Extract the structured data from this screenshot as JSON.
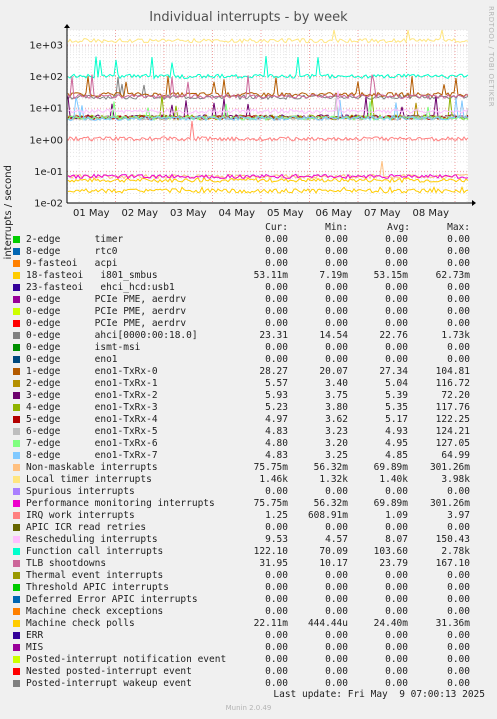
{
  "title": "Individual interrupts - by week",
  "side_label": "RRDTOOL / TOBI OETIKER",
  "footer": {
    "last_update": "Last update: Fri May  9 07:00:13 2025",
    "munin": "Munin 2.0.49"
  },
  "legend_headers": {
    "cur": "Cur:",
    "min": "Min:",
    "avg": "Avg:",
    "max": "Max:"
  },
  "chart_data": {
    "type": "line",
    "ylabel": "interrupts / second",
    "yscale": "log",
    "ylim": [
      0.01,
      3000
    ],
    "yticks": [
      "1e-02",
      "1e-01",
      "1e+00",
      "1e+01",
      "1e+02",
      "1e+03"
    ],
    "x_ticks": [
      "01 May",
      "02 May",
      "03 May",
      "04 May",
      "05 May",
      "06 May",
      "07 May",
      "08 May"
    ],
    "grid": true,
    "series": [
      {
        "name": "2-edge      timer",
        "color": "#00cc00",
        "cur": "0.00",
        "min": "0.00",
        "avg": "0.00",
        "max": "0.00"
      },
      {
        "name": "8-edge      rtc0",
        "color": "#0066b3",
        "cur": "0.00",
        "min": "0.00",
        "avg": "0.00",
        "max": "0.00"
      },
      {
        "name": "9-fasteoi   acpi",
        "color": "#ff8000",
        "cur": "0.00",
        "min": "0.00",
        "avg": "0.00",
        "max": "0.00"
      },
      {
        "name": "18-fasteoi   i801_smbus",
        "color": "#ffcc00",
        "cur": "53.11m",
        "min": "7.19m",
        "avg": "53.15m",
        "max": "62.73m"
      },
      {
        "name": "23-fasteoi   ehci_hcd:usb1",
        "color": "#330099",
        "cur": "0.00",
        "min": "0.00",
        "avg": "0.00",
        "max": "0.00"
      },
      {
        "name": "0-edge      PCIe PME, aerdrv",
        "color": "#990099",
        "cur": "0.00",
        "min": "0.00",
        "avg": "0.00",
        "max": "0.00"
      },
      {
        "name": "0-edge      PCIe PME, aerdrv",
        "color": "#ccff00",
        "cur": "0.00",
        "min": "0.00",
        "avg": "0.00",
        "max": "0.00"
      },
      {
        "name": "0-edge      PCIe PME, aerdrv",
        "color": "#ff0000",
        "cur": "0.00",
        "min": "0.00",
        "avg": "0.00",
        "max": "0.00"
      },
      {
        "name": "0-edge      ahci[0000:00:18.0]",
        "color": "#808080",
        "cur": "23.31",
        "min": "14.54",
        "avg": "22.76",
        "max": "1.73k"
      },
      {
        "name": "0-edge      ismt-msi",
        "color": "#008f00",
        "cur": "0.00",
        "min": "0.00",
        "avg": "0.00",
        "max": "0.00"
      },
      {
        "name": "0-edge      eno1",
        "color": "#00487d",
        "cur": "0.00",
        "min": "0.00",
        "avg": "0.00",
        "max": "0.00"
      },
      {
        "name": "1-edge      eno1-TxRx-0",
        "color": "#b35a00",
        "cur": "28.27",
        "min": "20.07",
        "avg": "27.34",
        "max": "104.81"
      },
      {
        "name": "2-edge      eno1-TxRx-1",
        "color": "#b38f00",
        "cur": "5.57",
        "min": "3.40",
        "avg": "5.04",
        "max": "116.72"
      },
      {
        "name": "3-edge      eno1-TxRx-2",
        "color": "#6b006b",
        "cur": "5.93",
        "min": "3.75",
        "avg": "5.39",
        "max": "72.20"
      },
      {
        "name": "4-edge      eno1-TxRx-3",
        "color": "#8fb300",
        "cur": "5.23",
        "min": "3.80",
        "avg": "5.35",
        "max": "117.76"
      },
      {
        "name": "5-edge      eno1-TxRx-4",
        "color": "#b30000",
        "cur": "4.97",
        "min": "3.62",
        "avg": "5.17",
        "max": "122.25"
      },
      {
        "name": "6-edge      eno1-TxRx-5",
        "color": "#bebebe",
        "cur": "4.83",
        "min": "3.23",
        "avg": "4.93",
        "max": "124.21"
      },
      {
        "name": "7-edge      eno1-TxRx-6",
        "color": "#80ff80",
        "cur": "4.80",
        "min": "3.20",
        "avg": "4.95",
        "max": "127.05"
      },
      {
        "name": "8-edge      eno1-TxRx-7",
        "color": "#80c9ff",
        "cur": "4.83",
        "min": "3.25",
        "avg": "4.85",
        "max": "64.99"
      },
      {
        "name": "Non-maskable interrupts",
        "color": "#ffc080",
        "cur": "75.75m",
        "min": "56.32m",
        "avg": "69.89m",
        "max": "301.26m"
      },
      {
        "name": "Local timer interrupts",
        "color": "#ffe680",
        "cur": "1.46k",
        "min": "1.32k",
        "avg": "1.40k",
        "max": "3.98k"
      },
      {
        "name": "Spurious interrupts",
        "color": "#aa80ff",
        "cur": "0.00",
        "min": "0.00",
        "avg": "0.00",
        "max": "0.00"
      },
      {
        "name": "Performance monitoring interrupts",
        "color": "#ee00cc",
        "cur": "75.75m",
        "min": "56.32m",
        "avg": "69.89m",
        "max": "301.26m"
      },
      {
        "name": "IRQ work interrupts",
        "color": "#ff8080",
        "cur": "1.25",
        "min": "608.91m",
        "avg": "1.09",
        "max": "3.97"
      },
      {
        "name": "APIC ICR read retries",
        "color": "#666600",
        "cur": "0.00",
        "min": "0.00",
        "avg": "0.00",
        "max": "0.00"
      },
      {
        "name": "Rescheduling interrupts",
        "color": "#ffbfff",
        "cur": "9.53",
        "min": "4.57",
        "avg": "8.07",
        "max": "150.43"
      },
      {
        "name": "Function call interrupts",
        "color": "#00ffcc",
        "cur": "122.10",
        "min": "70.09",
        "avg": "103.60",
        "max": "2.78k"
      },
      {
        "name": "TLB shootdowns",
        "color": "#cc6699",
        "cur": "31.95",
        "min": "10.17",
        "avg": "23.79",
        "max": "167.10"
      },
      {
        "name": "Thermal event interrupts",
        "color": "#999900",
        "cur": "0.00",
        "min": "0.00",
        "avg": "0.00",
        "max": "0.00"
      },
      {
        "name": "Threshold APIC interrupts",
        "color": "#00cc00",
        "cur": "0.00",
        "min": "0.00",
        "avg": "0.00",
        "max": "0.00"
      },
      {
        "name": "Deferred Error APIC interrupts",
        "color": "#0066b3",
        "cur": "0.00",
        "min": "0.00",
        "avg": "0.00",
        "max": "0.00"
      },
      {
        "name": "Machine check exceptions",
        "color": "#ff8000",
        "cur": "0.00",
        "min": "0.00",
        "avg": "0.00",
        "max": "0.00"
      },
      {
        "name": "Machine check polls",
        "color": "#ffcc00",
        "cur": "22.11m",
        "min": "444.44u",
        "avg": "24.40m",
        "max": "31.36m"
      },
      {
        "name": "ERR",
        "color": "#330099",
        "cur": "0.00",
        "min": "0.00",
        "avg": "0.00",
        "max": "0.00"
      },
      {
        "name": "MIS",
        "color": "#990099",
        "cur": "0.00",
        "min": "0.00",
        "avg": "0.00",
        "max": "0.00"
      },
      {
        "name": "Posted-interrupt notification event",
        "color": "#ccff00",
        "cur": "0.00",
        "min": "0.00",
        "avg": "0.00",
        "max": "0.00"
      },
      {
        "name": "Nested posted-interrupt event",
        "color": "#ff0000",
        "cur": "0.00",
        "min": "0.00",
        "avg": "0.00",
        "max": "0.00"
      },
      {
        "name": "Posted-interrupt wakeup event",
        "color": "#808080",
        "cur": "0.00",
        "min": "0.00",
        "avg": "0.00",
        "max": "0.00"
      }
    ]
  }
}
